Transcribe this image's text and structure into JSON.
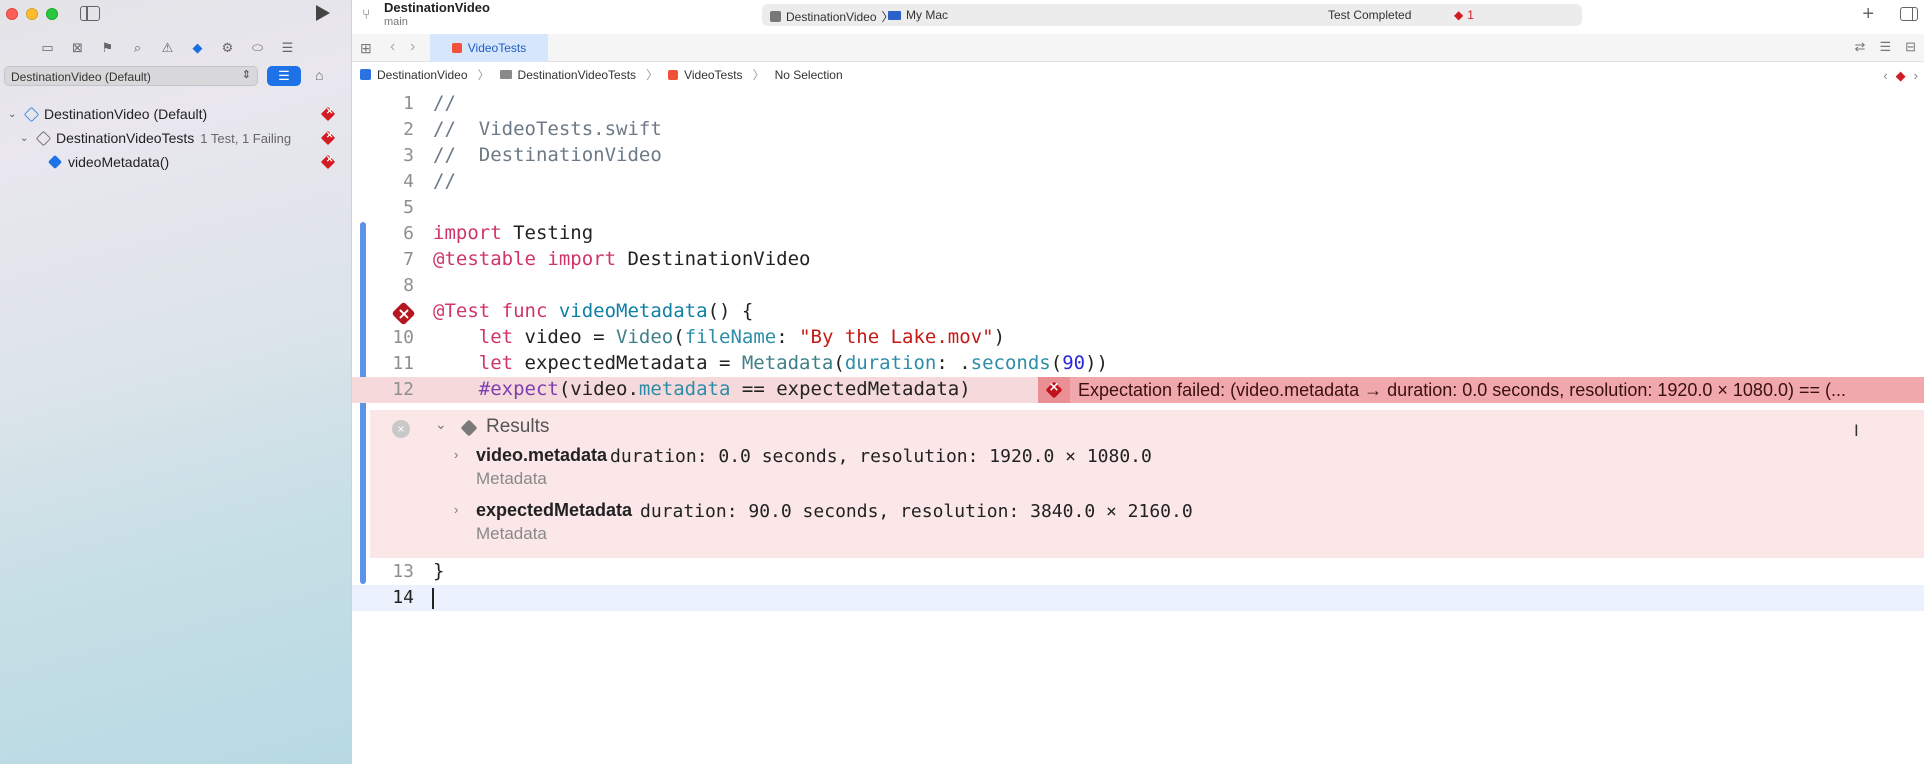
{
  "window": {
    "project_title": "DestinationVideo",
    "branch": "main",
    "activity": {
      "scheme": "DestinationVideo",
      "destination": "My Mac",
      "status": "Test Completed",
      "error_count": "1"
    }
  },
  "sidebar": {
    "scheme_filter": "DestinationVideo (Default)",
    "tree": [
      {
        "label": "DestinationVideo (Default)",
        "sub": ""
      },
      {
        "label": "DestinationVideoTests",
        "sub": "1 Test, 1 Failing"
      },
      {
        "label": "videoMetadata()",
        "sub": ""
      }
    ]
  },
  "tabs": {
    "active": "VideoTests"
  },
  "jumpbar": {
    "items": [
      "DestinationVideo",
      "DestinationVideoTests",
      "VideoTests",
      "No Selection"
    ]
  },
  "editor": {
    "line_numbers": [
      "1",
      "2",
      "3",
      "4",
      "5",
      "6",
      "7",
      "8",
      "9",
      "10",
      "11",
      "12",
      "13",
      "14"
    ],
    "code": {
      "l1": "//",
      "l2": "//  VideoTests.swift",
      "l3": "//  DestinationVideo",
      "l4": "//",
      "l6_kw": "import",
      "l6_rest": " Testing",
      "l7_attr": "@testable",
      "l7_kw": " import",
      "l7_rest": " DestinationVideo",
      "l9_attr": "@Test",
      "l9_kw": " func",
      "l9_fn": " videoMetadata",
      "l9_rest": "() {",
      "l10_kw": "    let",
      "l10_a": " video = ",
      "l10_ty": "Video",
      "l10_b": "(",
      "l10_lbl": "fileName",
      "l10_c": ": ",
      "l10_str": "\"By the Lake.mov\"",
      "l10_d": ")",
      "l11_kw": "    let",
      "l11_a": " expectedMetadata = ",
      "l11_ty": "Metadata",
      "l11_b": "(",
      "l11_lbl": "duration",
      "l11_c": ": .",
      "l11_prop": "seconds",
      "l11_d": "(",
      "l11_num": "90",
      "l11_e": "))",
      "l12_macro": "    #expect",
      "l12_a": "(video.",
      "l12_prop": "metadata",
      "l12_b": " == expectedMetadata)",
      "l13": "}"
    },
    "error_message": "Expectation failed: (video.metadata → duration: 0.0 seconds, resolution: 1920.0 × 1080.0) == (...",
    "results": {
      "title": "Results",
      "rows": [
        {
          "name": "video.metadata",
          "value": "duration: 0.0 seconds, resolution: 1920.0 × 1080.0",
          "type": "Metadata"
        },
        {
          "name": "expectedMetadata",
          "value": "duration: 90.0 seconds, resolution: 3840.0 × 2160.0",
          "type": "Metadata"
        }
      ]
    }
  },
  "colors": {
    "accent": "#1d72e8",
    "error": "#d21c24",
    "error_banner": "#f0a8ac",
    "results_bg": "#fbe7e8"
  }
}
